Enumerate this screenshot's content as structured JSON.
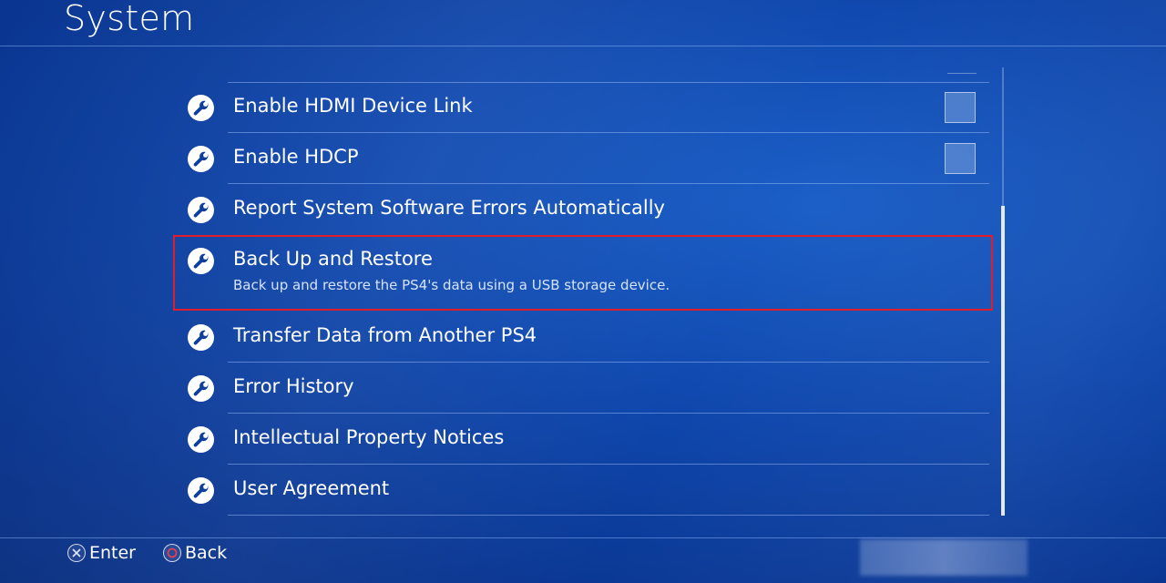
{
  "header": {
    "title": "System"
  },
  "settings": {
    "items": [
      {
        "label": "Enable HDMI Device Link",
        "has_checkbox": true,
        "checked": false
      },
      {
        "label": "Enable HDCP",
        "has_checkbox": true,
        "checked": false
      },
      {
        "label": "Report System Software Errors Automatically",
        "has_checkbox": false
      },
      {
        "label": "Back Up and Restore",
        "description": "Back up and restore the PS4's data using a USB storage device.",
        "selected": true
      },
      {
        "label": "Transfer Data from Another PS4",
        "has_checkbox": false
      },
      {
        "label": "Error History",
        "has_checkbox": false
      },
      {
        "label": "Intellectual Property Notices",
        "has_checkbox": false
      },
      {
        "label": "User Agreement",
        "has_checkbox": false
      }
    ],
    "item_icon": "wrench-icon"
  },
  "footer": {
    "enter_label": "Enter",
    "enter_icon": "cross-button-icon",
    "back_label": "Back",
    "back_icon": "circle-button-icon"
  },
  "colors": {
    "background": "#0f47ad",
    "selection_border": "#e01d2b",
    "text": "#ffffff",
    "circle_button": "#e04050"
  }
}
